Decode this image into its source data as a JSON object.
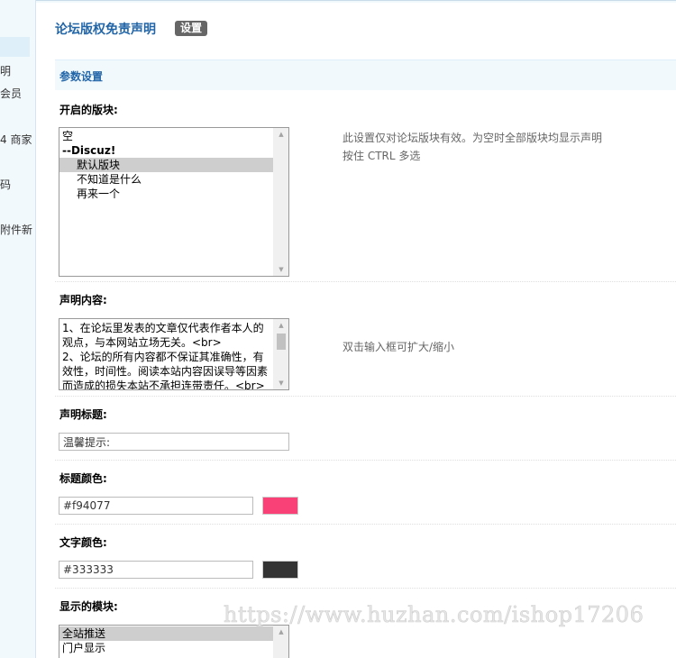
{
  "sidebar": {
    "items": [
      "明",
      "会员",
      "4 商家",
      "码",
      "附件新"
    ]
  },
  "header": {
    "title": "论坛版权免责声明",
    "badge": "设置"
  },
  "section": {
    "title": "参数设置"
  },
  "forums": {
    "label": "开启的版块:",
    "hint_line1": "此设置仅对论坛版块有效。为空时全部版块均显示声明",
    "hint_line2": "按住 CTRL 多选",
    "options": [
      {
        "text": "空",
        "kind": "plain",
        "selected": false
      },
      {
        "text": "--Discuz!",
        "kind": "group",
        "selected": false
      },
      {
        "text": "默认版块",
        "kind": "sub",
        "selected": true
      },
      {
        "text": "不知道是什么",
        "kind": "sub",
        "selected": false
      },
      {
        "text": "再来一个",
        "kind": "sub",
        "selected": false
      }
    ]
  },
  "content": {
    "label": "声明内容:",
    "text": "1、在论坛里发表的文章仅代表作者本人的观点，与本网站立场无关。<br>\n2、论坛的所有内容都不保证其准确性，有效性，时间性。阅读本站内容因误导等因素而造成的损失本站不承担连带责任。<br>",
    "hint": "双击输入框可扩大/缩小"
  },
  "title_field": {
    "label": "声明标题:",
    "value": "温馨提示:"
  },
  "title_color": {
    "label": "标题颜色:",
    "value": "#f94077",
    "swatch": "#f94077"
  },
  "text_color": {
    "label": "文字颜色:",
    "value": "#333333",
    "swatch": "#333333"
  },
  "modules": {
    "label": "显示的模块:",
    "options": [
      {
        "text": "全站推送",
        "selected": true
      },
      {
        "text": "门户显示",
        "selected": false
      }
    ]
  },
  "watermark": "https://www.huzhan.com/ishop17206"
}
